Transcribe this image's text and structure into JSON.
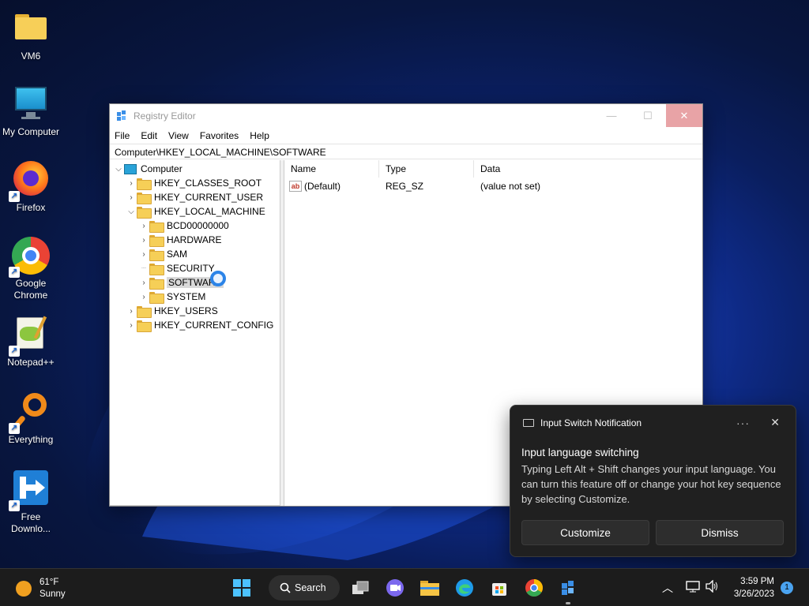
{
  "desktop": {
    "icons": [
      {
        "label": "VM6"
      },
      {
        "label": "My Computer"
      },
      {
        "label": "Firefox"
      },
      {
        "label": "Google Chrome"
      },
      {
        "label": "Notepad++"
      },
      {
        "label": "Everything"
      },
      {
        "label": "Free Downlo..."
      }
    ]
  },
  "window": {
    "title": "Registry Editor",
    "menu": [
      "File",
      "Edit",
      "View",
      "Favorites",
      "Help"
    ],
    "address": "Computer\\HKEY_LOCAL_MACHINE\\SOFTWARE",
    "tree": [
      {
        "label": "Computer"
      },
      {
        "label": "HKEY_CLASSES_ROOT"
      },
      {
        "label": "HKEY_CURRENT_USER"
      },
      {
        "label": "HKEY_LOCAL_MACHINE"
      },
      {
        "label": "BCD00000000"
      },
      {
        "label": "HARDWARE"
      },
      {
        "label": "SAM"
      },
      {
        "label": "SECURITY"
      },
      {
        "label": "SOFTWARE"
      },
      {
        "label": "SYSTEM"
      },
      {
        "label": "HKEY_USERS"
      },
      {
        "label": "HKEY_CURRENT_CONFIG"
      }
    ],
    "columns": [
      "Name",
      "Type",
      "Data"
    ],
    "rows": [
      {
        "name": "(Default)",
        "type": "REG_SZ",
        "data": "(value not set)"
      }
    ]
  },
  "notification": {
    "app": "Input Switch Notification",
    "more": "···",
    "close": "✕",
    "title": "Input language switching",
    "body": "Typing Left Alt + Shift changes your input language. You can turn this feature off or change your hot key sequence by selecting Customize.",
    "customize": "Customize",
    "dismiss": "Dismiss"
  },
  "taskbar": {
    "temperature": "61°F",
    "condition": "Sunny",
    "search": "Search",
    "time": "3:59 PM",
    "date": "3/26/2023",
    "badge": "1"
  }
}
